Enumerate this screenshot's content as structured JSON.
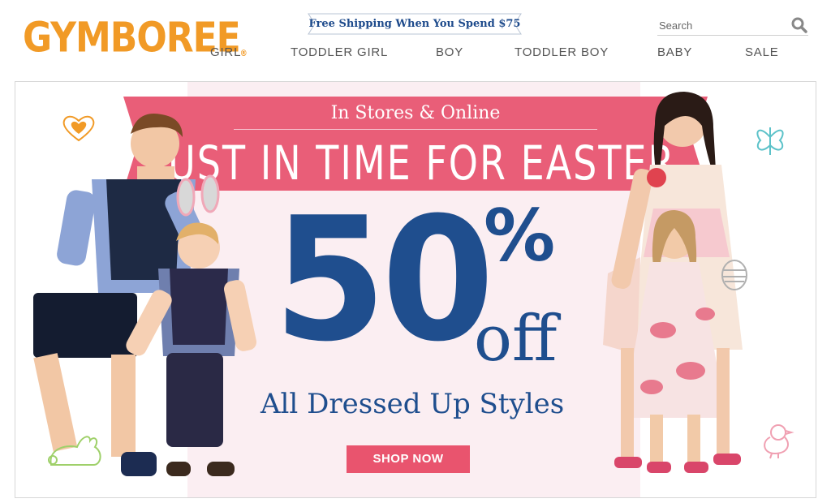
{
  "brand": {
    "logo_text": "GYMBOREE",
    "logo_mark": "®",
    "accent": "#f19a26"
  },
  "promo": {
    "text": "Free Shipping When You Spend $75"
  },
  "search": {
    "placeholder": "Search",
    "icon": "search-icon"
  },
  "nav": {
    "items": [
      {
        "label": "GIRL"
      },
      {
        "label": "TODDLER GIRL"
      },
      {
        "label": "BOY"
      },
      {
        "label": "TODDLER BOY"
      },
      {
        "label": "BABY"
      },
      {
        "label": "SALE"
      }
    ]
  },
  "banner": {
    "subheading": "In Stores & Online",
    "heading": "JUST IN TIME FOR EASTER",
    "discount_number": "50",
    "discount_percent": "%",
    "discount_off": "off",
    "tagline": "All Dressed Up Styles",
    "cta": "SHOP NOW",
    "colors": {
      "ribbon": "#e95e78",
      "panel": "#fbeef2",
      "text_blue": "#1f4e8e",
      "cta": "#e9546e"
    },
    "doodles": [
      "heart-icon",
      "butterfly-icon",
      "bunny-icon",
      "chick-icon",
      "easter-egg-icon"
    ]
  }
}
